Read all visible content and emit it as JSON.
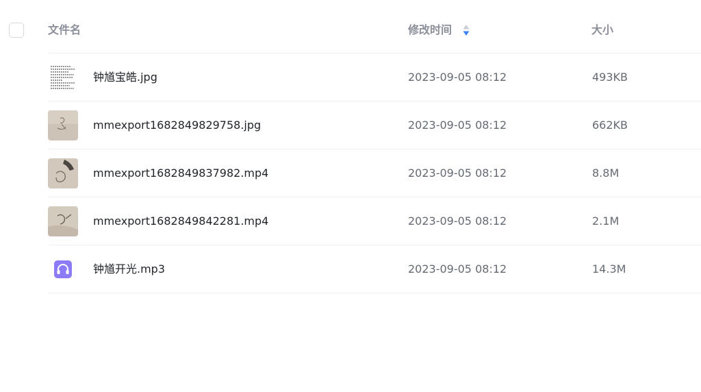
{
  "header": {
    "name_label": "文件名",
    "time_label": "修改时间",
    "size_label": "大小",
    "sort_active_color": "#3b82f6"
  },
  "files": [
    {
      "name": "钟馗宝皓.jpg",
      "modified": "2023-09-05 08:12",
      "size": "493KB",
      "thumb": "document-thumbnail"
    },
    {
      "name": "mmexport1682849829758.jpg",
      "modified": "2023-09-05 08:12",
      "size": "662KB",
      "thumb": "photo-thumbnail"
    },
    {
      "name": "mmexport1682849837982.mp4",
      "modified": "2023-09-05 08:12",
      "size": "8.8M",
      "thumb": "video-thumbnail"
    },
    {
      "name": "mmexport1682849842281.mp4",
      "modified": "2023-09-05 08:12",
      "size": "2.1M",
      "thumb": "video-thumbnail"
    },
    {
      "name": "钟馗开光.mp3",
      "modified": "2023-09-05 08:12",
      "size": "14.3M",
      "thumb": "audio-headphones-icon"
    }
  ]
}
